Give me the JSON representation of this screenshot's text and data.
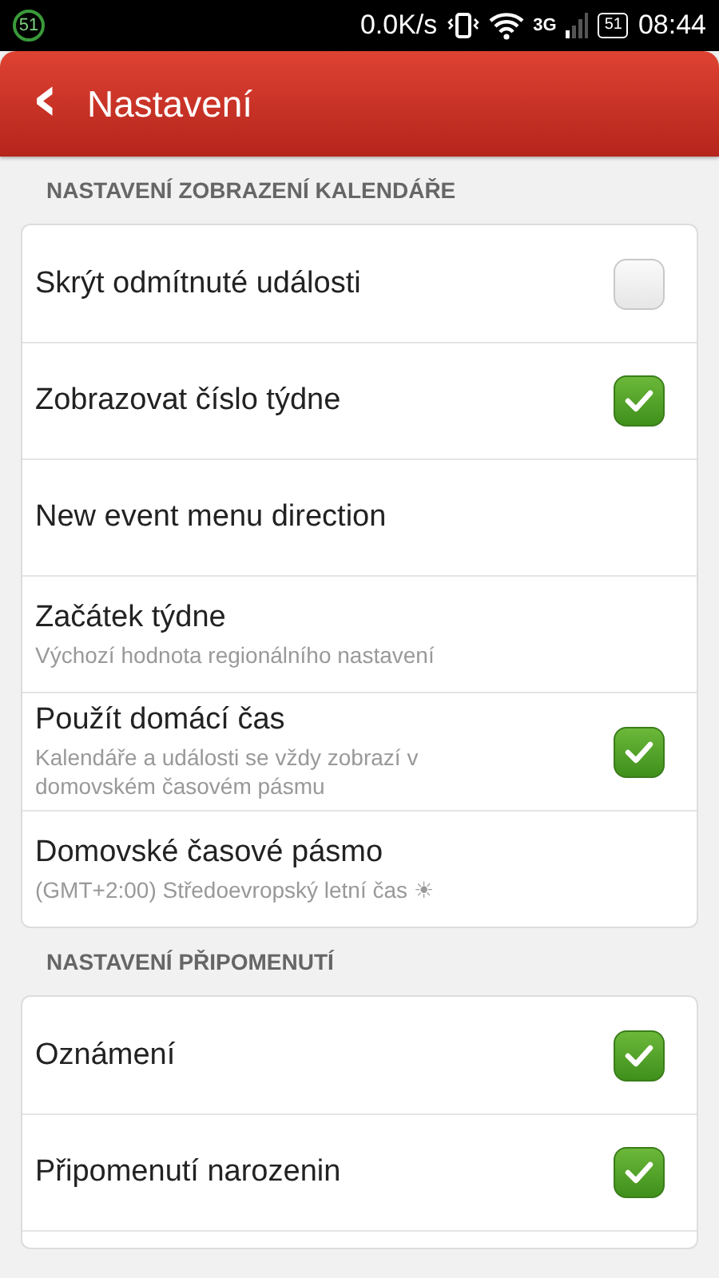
{
  "status_bar": {
    "badge": "51",
    "speed": "0.0K/s",
    "network": "3G",
    "battery": "51",
    "time": "08:44"
  },
  "header": {
    "back": "‹",
    "title": "Nastavení"
  },
  "sections": [
    {
      "title": "NASTAVENÍ ZOBRAZENÍ KALENDÁŘE",
      "items": [
        {
          "kind": "checkbox",
          "title": "Skrýt odmítnuté události",
          "checked": false
        },
        {
          "kind": "checkbox",
          "title": "Zobrazovat číslo týdne",
          "checked": true
        },
        {
          "kind": "plain",
          "title": "New event menu direction"
        },
        {
          "kind": "plain",
          "title": "Začátek týdne",
          "subtitle": "Výchozí hodnota regionálního nastavení"
        },
        {
          "kind": "checkbox",
          "title": "Použít domácí čas",
          "subtitle": "Kalendáře a události se vždy zobrazí v domovském časovém pásmu",
          "checked": true
        },
        {
          "kind": "plain",
          "title": "Domovské časové pásmo",
          "subtitle": "(GMT+2:00) Středoevropský letní čas ☀"
        }
      ]
    },
    {
      "title": "NASTAVENÍ PŘIPOMENUTÍ",
      "items": [
        {
          "kind": "checkbox",
          "title": "Oznámení",
          "checked": true
        },
        {
          "kind": "checkbox",
          "title": "Připomenutí narozenin",
          "checked": true
        }
      ]
    }
  ]
}
